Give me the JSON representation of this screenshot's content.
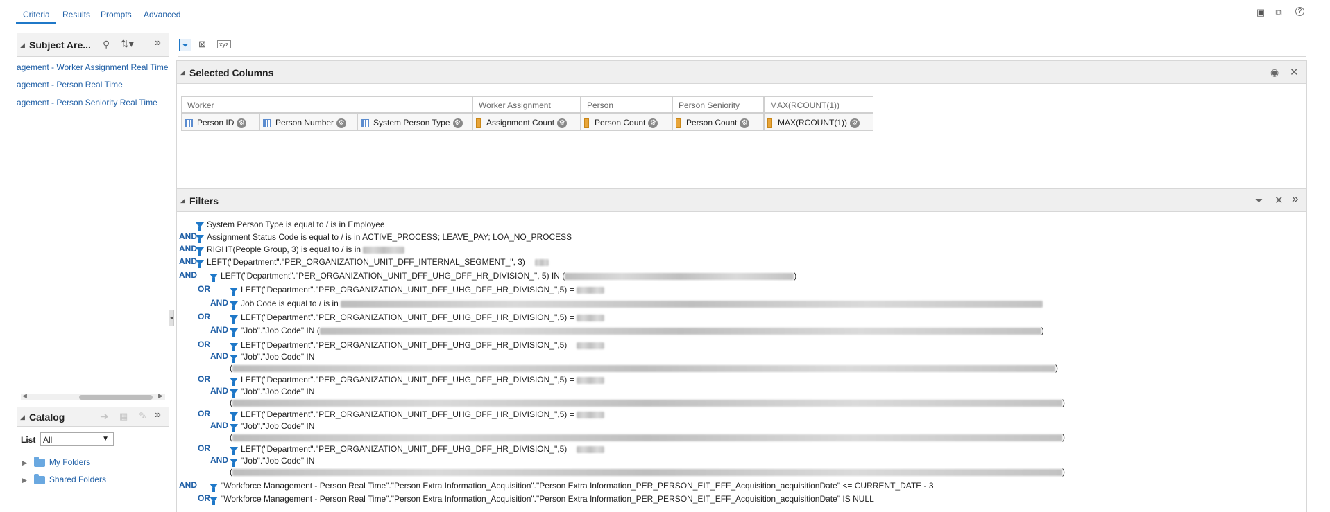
{
  "tabs": [
    "Criteria",
    "Results",
    "Prompts",
    "Advanced"
  ],
  "subject_area": {
    "title": "Subject Are...",
    "items": [
      "agement - Worker Assignment Real Time",
      "agement - Person Real Time",
      "agement - Person Seniority Real Time"
    ]
  },
  "catalog": {
    "title": "Catalog",
    "list_label": "List",
    "list_value": "All",
    "folders": [
      "My Folders",
      "Shared Folders"
    ]
  },
  "selected_columns": {
    "title": "Selected Columns",
    "groups": [
      {
        "name": "Worker",
        "columns": [
          "Person ID",
          "Person Number",
          "System Person Type"
        ]
      },
      {
        "name": "Worker Assignment",
        "columns": [
          "Assignment Count"
        ]
      },
      {
        "name": "Person",
        "columns": [
          "Person Count"
        ]
      },
      {
        "name": "Person Seniority",
        "columns": [
          "Person Count"
        ]
      },
      {
        "name": "MAX(RCOUNT(1))",
        "columns": [
          "MAX(RCOUNT(1))"
        ]
      }
    ]
  },
  "filters": {
    "title": "Filters",
    "rows": [
      {
        "op": "",
        "text": "System Person Type is equal to / is in  Employee"
      },
      {
        "op": "AND",
        "text": "Assignment Status Code is equal to / is in  ACTIVE_PROCESS; LEAVE_PAY; LOA_NO_PROCESS"
      },
      {
        "op": "AND",
        "text": "RIGHT(People Group, 3) is equal to / is in"
      },
      {
        "op": "AND",
        "text": "LEFT(\"Department\".\"PER_ORGANIZATION_UNIT_DFF_INTERNAL_SEGMENT_\", 3) ="
      },
      {
        "op": "AND",
        "text": "LEFT(\"Department\".\"PER_ORGANIZATION_UNIT_DFF_UHG_DFF_HR_DIVISION_\", 5) IN ("
      },
      {
        "op": "OR",
        "text": "LEFT(\"Department\".\"PER_ORGANIZATION_UNIT_DFF_UHG_DFF_HR_DIVISION_\",5) ="
      },
      {
        "op": "AND",
        "text": "Job Code is equal to / is in"
      },
      {
        "op": "OR",
        "text": "LEFT(\"Department\".\"PER_ORGANIZATION_UNIT_DFF_UHG_DFF_HR_DIVISION_\",5) ="
      },
      {
        "op": "AND",
        "text": "\"Job\".\"Job Code\" IN ("
      },
      {
        "op": "OR",
        "text": "LEFT(\"Department\".\"PER_ORGANIZATION_UNIT_DFF_UHG_DFF_HR_DIVISION_\",5) ="
      },
      {
        "op": "AND",
        "text": "\"Job\".\"Job Code\" IN"
      },
      {
        "op": "OR",
        "text": "LEFT(\"Department\".\"PER_ORGANIZATION_UNIT_DFF_UHG_DFF_HR_DIVISION_\",5) ="
      },
      {
        "op": "AND",
        "text": "\"Job\".\"Job Code\" IN"
      },
      {
        "op": "OR",
        "text": "LEFT(\"Department\".\"PER_ORGANIZATION_UNIT_DFF_UHG_DFF_HR_DIVISION_\",5) ="
      },
      {
        "op": "AND",
        "text": "\"Job\".\"Job Code\" IN"
      },
      {
        "op": "OR",
        "text": "LEFT(\"Department\".\"PER_ORGANIZATION_UNIT_DFF_UHG_DFF_HR_DIVISION_\",5) ="
      },
      {
        "op": "AND",
        "text": "\"Job\".\"Job Code\" IN"
      },
      {
        "op": "AND",
        "text": "\"Workforce Management - Person Real Time\".\"Person Extra Information_Acquisition\".\"Person Extra Information_PER_PERSON_EIT_EFF_Acquisition_acquisitionDate\" <= CURRENT_DATE - 3"
      },
      {
        "op": "OR",
        "text": "\"Workforce Management - Person Real Time\".\"Person Extra Information_Acquisition\".\"Person Extra Information_PER_PERSON_EIT_EFF_Acquisition_acquisitionDate\" IS NULL"
      }
    ]
  },
  "icons": {
    "save": "save-icon",
    "save_as": "save-as-icon",
    "help": "help-icon",
    "search": "search-icon",
    "sort": "sort-icon",
    "expand": "expand-icon",
    "filter": "filter-icon",
    "gear": "gear-icon",
    "folder": "folder-icon"
  },
  "colors": {
    "accent": "#1f78c8",
    "link": "#1f5fa6",
    "measure": "#e8a53a"
  }
}
